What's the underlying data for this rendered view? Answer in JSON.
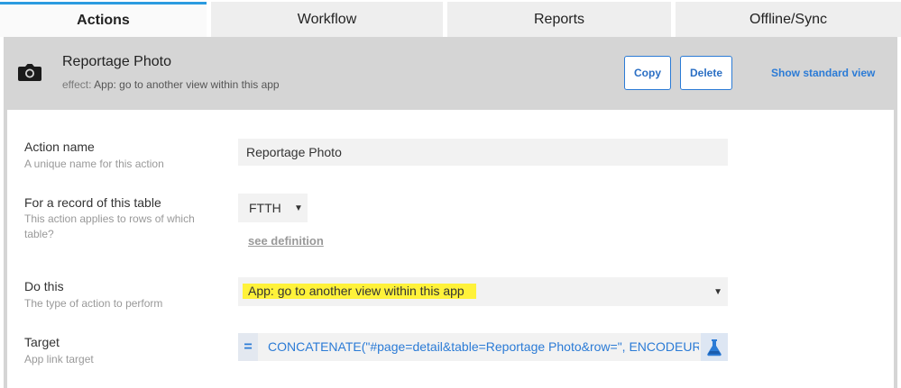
{
  "tabs": [
    {
      "label": "Actions",
      "active": true
    },
    {
      "label": "Workflow",
      "active": false
    },
    {
      "label": "Reports",
      "active": false
    },
    {
      "label": "Offline/Sync",
      "active": false
    }
  ],
  "header": {
    "icon": "camera-icon",
    "title": "Reportage Photo",
    "effect_label": "effect:",
    "effect_value": "App: go to another view within this app",
    "copy_label": "Copy",
    "delete_label": "Delete",
    "standard_view_label": "Show standard view"
  },
  "fields": {
    "action_name": {
      "label": "Action name",
      "help": "A unique name for this action",
      "value": "Reportage Photo"
    },
    "table": {
      "label": "For a record of this table",
      "help": "This action applies to rows of which table?",
      "value": "FTTH",
      "see_definition": "see definition"
    },
    "do_this": {
      "label": "Do this",
      "help": "The type of action to perform",
      "value": "App: go to another view within this app"
    },
    "target": {
      "label": "Target",
      "help": "App link target",
      "expression": "CONCATENATE(\"#page=detail&table=Reportage Photo&row=\", ENCODEURL([",
      "eq_symbol": "="
    }
  },
  "colors": {
    "accent": "#2b7bd6",
    "tab_indicator": "#2b9be0",
    "highlight": "#fff23a"
  }
}
